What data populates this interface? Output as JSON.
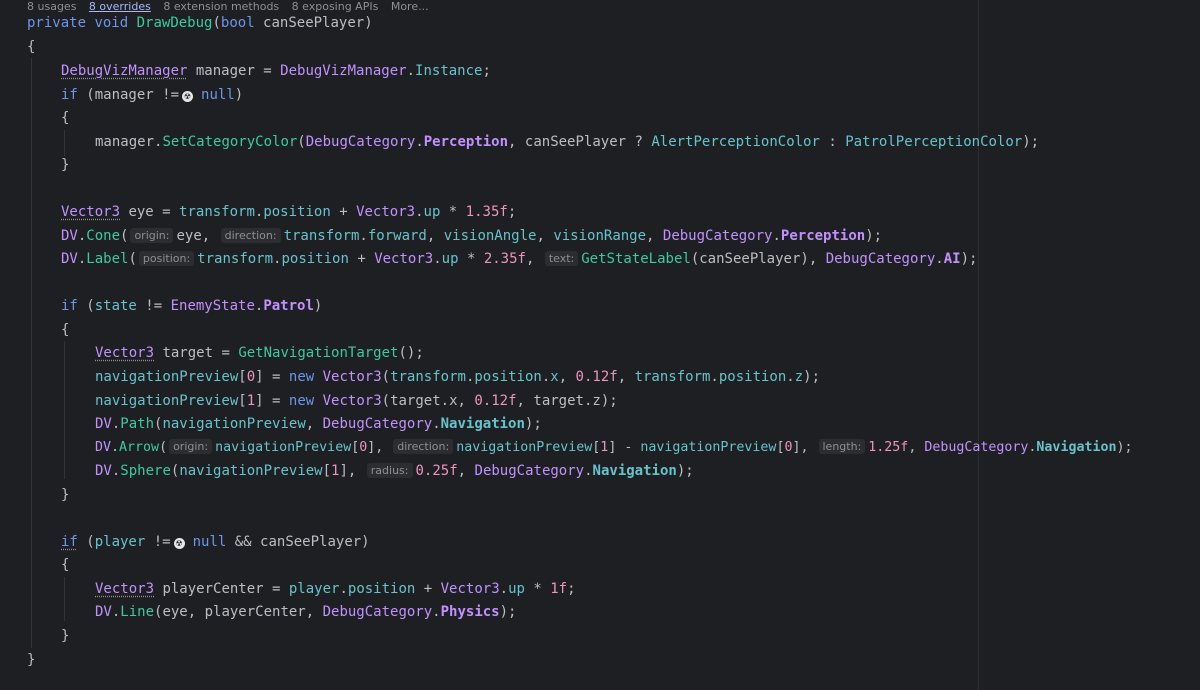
{
  "hints": {
    "usages": "8 usages",
    "overrides": "8 overrides",
    "extension_methods": "8 extension methods",
    "exposing_apis": "8 exposing APIs",
    "more": "More..."
  },
  "inlay": {
    "origin": "origin:",
    "direction": "direction:",
    "position": "position:",
    "text": "text:",
    "length": "length:",
    "radius": "radius:",
    "bug_glyph": "☢"
  },
  "code": {
    "l1": {
      "t1": "private",
      "t2": " ",
      "t3": "void",
      "t4": " ",
      "t5": "DrawDebug",
      "t6": "(",
      "t7": "bool",
      "t8": " canSeePlayer)"
    },
    "l2": {
      "t1": "{"
    },
    "l3": {
      "t1": "DebugVizManager",
      "t2": " manager = ",
      "t3": "DebugVizManager",
      "t4": ".",
      "t5": "Instance",
      "t6": ";"
    },
    "l4": {
      "t1": "if",
      "t2": " (manager !=",
      "t3": "null",
      "t4": ")"
    },
    "l5": {
      "t1": "{"
    },
    "l6": {
      "t1": "manager.",
      "t2": "SetCategoryColor",
      "t3": "(",
      "t4": "DebugCategory",
      "t5": ".",
      "t6": "Perception",
      "t7": ", canSeePlayer ? ",
      "t8": "AlertPerceptionColor",
      "t9": " : ",
      "t10": "PatrolPerceptionColor",
      "t11": ");"
    },
    "l7": {
      "t1": "}"
    },
    "l8": {
      "t1": "Vector3",
      "t2": " eye = ",
      "t3": "transform",
      "t4": ".",
      "t5": "position",
      "t6": " + ",
      "t7": "Vector3",
      "t8": ".",
      "t9": "up",
      "t10": " * ",
      "t11": "1.35f",
      "t12": ";"
    },
    "l9": {
      "t1": "DV",
      "t2": ".",
      "t3": "Cone",
      "t4": "(",
      "t5": "eye, ",
      "t6": "transform",
      "t7": ".",
      "t8": "forward",
      "t9": ", ",
      "t10": "visionAngle",
      "t11": ", ",
      "t12": "visionRange",
      "t13": ", ",
      "t14": "DebugCategory",
      "t15": ".",
      "t16": "Perception",
      "t17": ");"
    },
    "l10": {
      "t1": "DV",
      "t2": ".",
      "t3": "Label",
      "t4": "(",
      "t5": "transform",
      "t6": ".",
      "t7": "position",
      "t8": " + ",
      "t9": "Vector3",
      "t10": ".",
      "t11": "up",
      "t12": " * ",
      "t13": "2.35f",
      "t14": ", ",
      "t15": "GetStateLabel",
      "t16": "(canSeePlayer), ",
      "t17": "DebugCategory",
      "t18": ".",
      "t19": "AI",
      "t20": ");"
    },
    "l11": {
      "t1": "if",
      "t2": " (",
      "t3": "state",
      "t4": " != ",
      "t5": "EnemyState",
      "t6": ".",
      "t7": "Patrol",
      "t8": ")"
    },
    "l12": {
      "t1": "{"
    },
    "l13": {
      "t1": "Vector3",
      "t2": " target = ",
      "t3": "GetNavigationTarget",
      "t4": "();"
    },
    "l14": {
      "t1": "navigationPreview",
      "t2": "[",
      "t3": "0",
      "t4": "] = ",
      "t5": "new",
      "t6": " ",
      "t7": "Vector3",
      "t8": "(",
      "t9": "transform",
      "t10": ".",
      "t11": "position",
      "t12": ".",
      "t13": "x",
      "t14": ", ",
      "t15": "0.12f",
      "t16": ", ",
      "t17": "transform",
      "t18": ".",
      "t19": "position",
      "t20": ".",
      "t21": "z",
      "t22": ");"
    },
    "l15": {
      "t1": "navigationPreview",
      "t2": "[",
      "t3": "1",
      "t4": "] = ",
      "t5": "new",
      "t6": " ",
      "t7": "Vector3",
      "t8": "(target.",
      "t9": "x",
      "t10": ", ",
      "t11": "0.12f",
      "t12": ", target.",
      "t13": "z",
      "t14": ");"
    },
    "l16": {
      "t1": "DV",
      "t2": ".",
      "t3": "Path",
      "t4": "(",
      "t5": "navigationPreview",
      "t6": ", ",
      "t7": "DebugCategory",
      "t8": ".",
      "t9": "Navigation",
      "t10": ");"
    },
    "l17": {
      "t1": "DV",
      "t2": ".",
      "t3": "Arrow",
      "t4": "(",
      "t5": "navigationPreview",
      "t6": "[",
      "t7": "0",
      "t8": "], ",
      "t9": "navigationPreview",
      "t10": "[",
      "t11": "1",
      "t12": "] - ",
      "t13": "navigationPreview",
      "t14": "[",
      "t15": "0",
      "t16": "], ",
      "t17": "1.25f",
      "t18": ", ",
      "t19": "DebugCategory",
      "t20": ".",
      "t21": "Navigation",
      "t22": ");"
    },
    "l18": {
      "t1": "DV",
      "t2": ".",
      "t3": "Sphere",
      "t4": "(",
      "t5": "navigationPreview",
      "t6": "[",
      "t7": "1",
      "t8": "], ",
      "t9": "0.25f",
      "t10": ", ",
      "t11": "DebugCategory",
      "t12": ".",
      "t13": "Navigation",
      "t14": ");"
    },
    "l19": {
      "t1": "}"
    },
    "l20": {
      "t1": "if",
      "t2": " (",
      "t3": "player",
      "t4": " !=",
      "t5": "null",
      "t6": " && canSeePlayer)"
    },
    "l21": {
      "t1": "{"
    },
    "l22": {
      "t1": "Vector3",
      "t2": " playerCenter = ",
      "t3": "player",
      "t4": ".",
      "t5": "position",
      "t6": " + ",
      "t7": "Vector3",
      "t8": ".",
      "t9": "up",
      "t10": " * ",
      "t11": "1f",
      "t12": ";"
    },
    "l23": {
      "t1": "DV",
      "t2": ".",
      "t3": "Line",
      "t4": "(eye, playerCenter, ",
      "t5": "DebugCategory",
      "t6": ".",
      "t7": "Physics",
      "t8": ");"
    },
    "l24": {
      "t1": "}"
    },
    "l25": {
      "t1": "}"
    }
  }
}
